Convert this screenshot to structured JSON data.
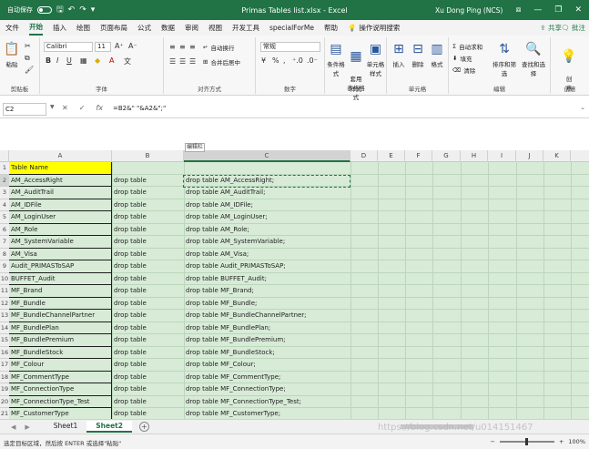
{
  "titlebar": {
    "autosave_label": "自动保存",
    "title": "Primas Tables list.xlsx  -  Excel",
    "user": "Xu Dong Ping (NCS)"
  },
  "tabs": [
    "文件",
    "开始",
    "插入",
    "绘图",
    "页面布局",
    "公式",
    "数据",
    "审阅",
    "视图",
    "开发工具",
    "specialForMe",
    "帮助"
  ],
  "active_tab": "开始",
  "tell_me": "操作说明搜索",
  "share_label": "共享",
  "comment_label": "批注",
  "ribbon": {
    "clipboard": {
      "paste": "粘贴",
      "label": "剪贴板"
    },
    "font": {
      "name": "Calibri",
      "size": "11",
      "label": "字体"
    },
    "alignment": {
      "wrap": "自动换行",
      "merge": "合并后居中",
      "label": "对齐方式"
    },
    "number": {
      "format": "常规",
      "label": "数字"
    },
    "styles": {
      "conditional": "条件格式",
      "table": "套用\n表格格式",
      "cell": "单元格样式",
      "label": "样式"
    },
    "cells": {
      "insert": "插入",
      "delete": "删除",
      "format": "格式",
      "label": "单元格"
    },
    "editing": {
      "autosum": "自动求和",
      "fill": "填充",
      "clear": "清除",
      "sort": "排序和筛选",
      "find": "查找和选择",
      "label": "编辑"
    },
    "ideas": {
      "ideas": "创\n意",
      "label": "创意"
    }
  },
  "formula": {
    "namebox": "C2",
    "text": "=B2&\" \"&A2&\";\""
  },
  "edit_tag": "编辑栏",
  "columns": [
    "A",
    "B",
    "C",
    "D",
    "E",
    "F",
    "G",
    "H",
    "I",
    "J",
    "K"
  ],
  "selected_column": "C",
  "rows": {
    "header": "Table Name",
    "names": [
      "AM_AccessRight",
      "AM_AuditTrail",
      "AM_IDFile",
      "AM_LoginUser",
      "AM_Role",
      "AM_SystemVariable",
      "AM_Visa",
      "Audit_PRIMASToSAP",
      "BUFFET_Audit",
      "MF_Brand",
      "MF_Bundle",
      "MF_BundleChannelPartner",
      "MF_BundlePlan",
      "MF_BundlePremium",
      "MF_BundleStock",
      "MF_Colour",
      "MF_CommentType",
      "MF_ConnectionType",
      "MF_ConnectionType_Test",
      "MF_CustomerType"
    ],
    "b_values": [
      "drop table",
      "drop table",
      "drop table",
      "drop table",
      "drop table",
      "drop table",
      "drop table",
      "drop table",
      "drop table",
      "drop table",
      "drop table",
      "drop table",
      "drop table",
      "drop table",
      "drop table",
      "drop table",
      "drop table",
      "drop table",
      "drop table",
      "drop table"
    ],
    "c_values": [
      "drop table AM_AccessRight;",
      "drop table AM_AuditTrail;",
      "drop table AM_IDFile;",
      "drop table AM_LoginUser;",
      "drop table AM_Role;",
      "drop table AM_SystemVariable;",
      "drop table AM_Visa;",
      "drop table Audit_PRIMASToSAP;",
      "drop table BUFFET_Audit;",
      "drop table MF_Brand;",
      "drop table MF_Bundle;",
      "drop table MF_BundleChannelPartner;",
      "drop table MF_BundlePlan;",
      "drop table MF_BundlePremium;",
      "drop table MF_BundleStock;",
      "drop table MF_Colour;",
      "drop table MF_CommentType;",
      "drop table MF_ConnectionType;",
      "drop table MF_ConnectionType_Test;",
      "drop table MF_CustomerType;"
    ],
    "numbers": [
      "1",
      "2",
      "3",
      "4",
      "5",
      "6",
      "7",
      "8",
      "9",
      "10",
      "11",
      "12",
      "13",
      "14",
      "15",
      "16",
      "17",
      "18",
      "19",
      "20",
      "21"
    ]
  },
  "sheets": [
    "Sheet1",
    "Sheet2"
  ],
  "active_sheet": "Sheet2",
  "status": "选定目标区域，然后按 ENTER 或选择\"粘贴\"",
  "watermark": "https://blog.csdn.net/u014151467",
  "zoom": "100%",
  "colors": {
    "excel_green": "#217346",
    "selection_fill": "#d7ebd7",
    "header_yellow": "#ffff00"
  }
}
